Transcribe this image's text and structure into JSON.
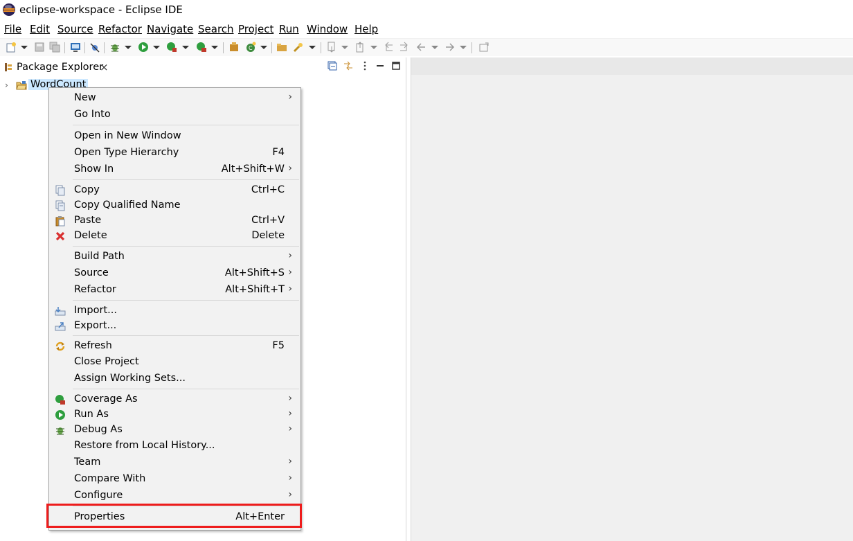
{
  "window": {
    "title": "eclipse-workspace - Eclipse IDE"
  },
  "menubar": {
    "items": [
      {
        "label": "File"
      },
      {
        "label": "Edit"
      },
      {
        "label": "Source"
      },
      {
        "label": "Refactor"
      },
      {
        "label": "Navigate"
      },
      {
        "label": "Search"
      },
      {
        "label": "Project"
      },
      {
        "label": "Run"
      },
      {
        "label": "Window"
      },
      {
        "label": "Help"
      }
    ]
  },
  "package_explorer": {
    "tab_label": "Package Explorer",
    "tab_close": "×",
    "tree": [
      {
        "label": "WordCount",
        "expander": "›"
      }
    ]
  },
  "context_menu": {
    "items": [
      {
        "label": "New",
        "accel": "",
        "submenu": true
      },
      {
        "label": "Go Into",
        "accel": ""
      },
      {
        "label": "Open in New Window",
        "accel": ""
      },
      {
        "label": "Open Type Hierarchy",
        "accel": "F4"
      },
      {
        "label": "Show In",
        "accel": "Alt+Shift+W",
        "submenu": true
      },
      {
        "label": "Copy",
        "accel": "Ctrl+C",
        "icon": "copy-icon"
      },
      {
        "label": "Copy Qualified Name",
        "accel": "",
        "icon": "copy-qualified-name-icon"
      },
      {
        "label": "Paste",
        "accel": "Ctrl+V",
        "icon": "paste-icon"
      },
      {
        "label": "Delete",
        "accel": "Delete",
        "icon": "delete-icon"
      },
      {
        "label": "Build Path",
        "accel": "",
        "submenu": true
      },
      {
        "label": "Source",
        "accel": "Alt+Shift+S",
        "submenu": true
      },
      {
        "label": "Refactor",
        "accel": "Alt+Shift+T",
        "submenu": true
      },
      {
        "label": "Import...",
        "accel": "",
        "icon": "import-icon"
      },
      {
        "label": "Export...",
        "accel": "",
        "icon": "export-icon"
      },
      {
        "label": "Refresh",
        "accel": "F5",
        "icon": "refresh-icon"
      },
      {
        "label": "Close Project",
        "accel": ""
      },
      {
        "label": "Assign Working Sets...",
        "accel": ""
      },
      {
        "label": "Coverage As",
        "accel": "",
        "submenu": true,
        "icon": "coverage-icon"
      },
      {
        "label": "Run As",
        "accel": "",
        "submenu": true,
        "icon": "run-icon"
      },
      {
        "label": "Debug As",
        "accel": "",
        "submenu": true,
        "icon": "debug-icon"
      },
      {
        "label": "Restore from Local History...",
        "accel": ""
      },
      {
        "label": "Team",
        "accel": "",
        "submenu": true
      },
      {
        "label": "Compare With",
        "accel": "",
        "submenu": true
      },
      {
        "label": "Configure",
        "accel": "",
        "submenu": true
      },
      {
        "label": "Properties",
        "accel": "Alt+Enter"
      }
    ],
    "submenu_arrow": "›"
  },
  "colors": {
    "highlight_border": "#ee1c1c",
    "selection": "#cce8ff",
    "menu_bg": "#f2f2f2"
  }
}
